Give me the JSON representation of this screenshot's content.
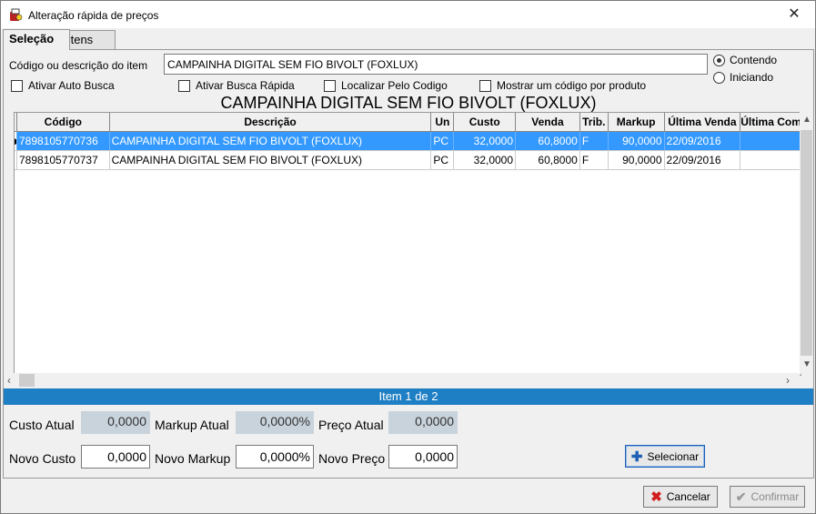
{
  "window": {
    "title": "Alteração rápida de preços"
  },
  "tabs": [
    {
      "label": "Seleção"
    },
    {
      "label": "Itens"
    }
  ],
  "search": {
    "label": "Código ou descrição do item",
    "value": "CAMPAINHA DIGITAL SEM FIO BIVOLT (FOXLUX)"
  },
  "radios": {
    "contendo": "Contendo",
    "iniciando": "Iniciando",
    "selected": "contendo"
  },
  "checkboxes": {
    "auto_busca": "Ativar Auto Busca",
    "busca_rapida": "Ativar Busca Rápida",
    "localizar_codigo": "Localizar Pelo Codigo",
    "mostrar_codigo": "Mostrar um código por produto"
  },
  "product_title": "CAMPAINHA DIGITAL SEM FIO BIVOLT (FOXLUX)",
  "grid": {
    "columns": [
      "Código",
      "Descrição",
      "Un",
      "Custo",
      "Venda",
      "Trib.",
      "Markup",
      "Última  Venda",
      "Última Com"
    ],
    "rows": [
      {
        "codigo": "7898105770736",
        "descricao": "CAMPAINHA DIGITAL SEM FIO BIVOLT (FOXLUX)",
        "un": "PC",
        "custo": "32,0000",
        "venda": "60,8000",
        "trib": "F",
        "markup": "90,0000",
        "ultima_venda": "22/09/2016",
        "ultima_compra": ""
      },
      {
        "codigo": "7898105770737",
        "descricao": "CAMPAINHA DIGITAL SEM FIO BIVOLT (FOXLUX)",
        "un": "PC",
        "custo": "32,0000",
        "venda": "60,8000",
        "trib": "F",
        "markup": "90,0000",
        "ultima_venda": "22/09/2016",
        "ultima_compra": ""
      }
    ]
  },
  "status_bar": "Item 1 de 2",
  "fields": {
    "custo_atual_label": "Custo Atual",
    "custo_atual": "0,0000",
    "markup_atual_label": "Markup Atual",
    "markup_atual": "0,0000%",
    "preco_atual_label": "Preço Atual",
    "preco_atual": "0,0000",
    "novo_custo_label": "Novo Custo",
    "novo_custo": "0,0000",
    "novo_markup_label": "Novo Markup",
    "novo_markup": "0,0000%",
    "novo_preco_label": "Novo Preço",
    "novo_preco": "0,0000"
  },
  "buttons": {
    "selecionar": "Selecionar",
    "cancelar": "Cancelar",
    "confirmar": "Confirmar"
  },
  "colors": {
    "selected_row": "#3399ff",
    "status_bar": "#1f7fc4",
    "cancel_icon": "#d21c1c",
    "select_icon": "#1f5fb4"
  }
}
